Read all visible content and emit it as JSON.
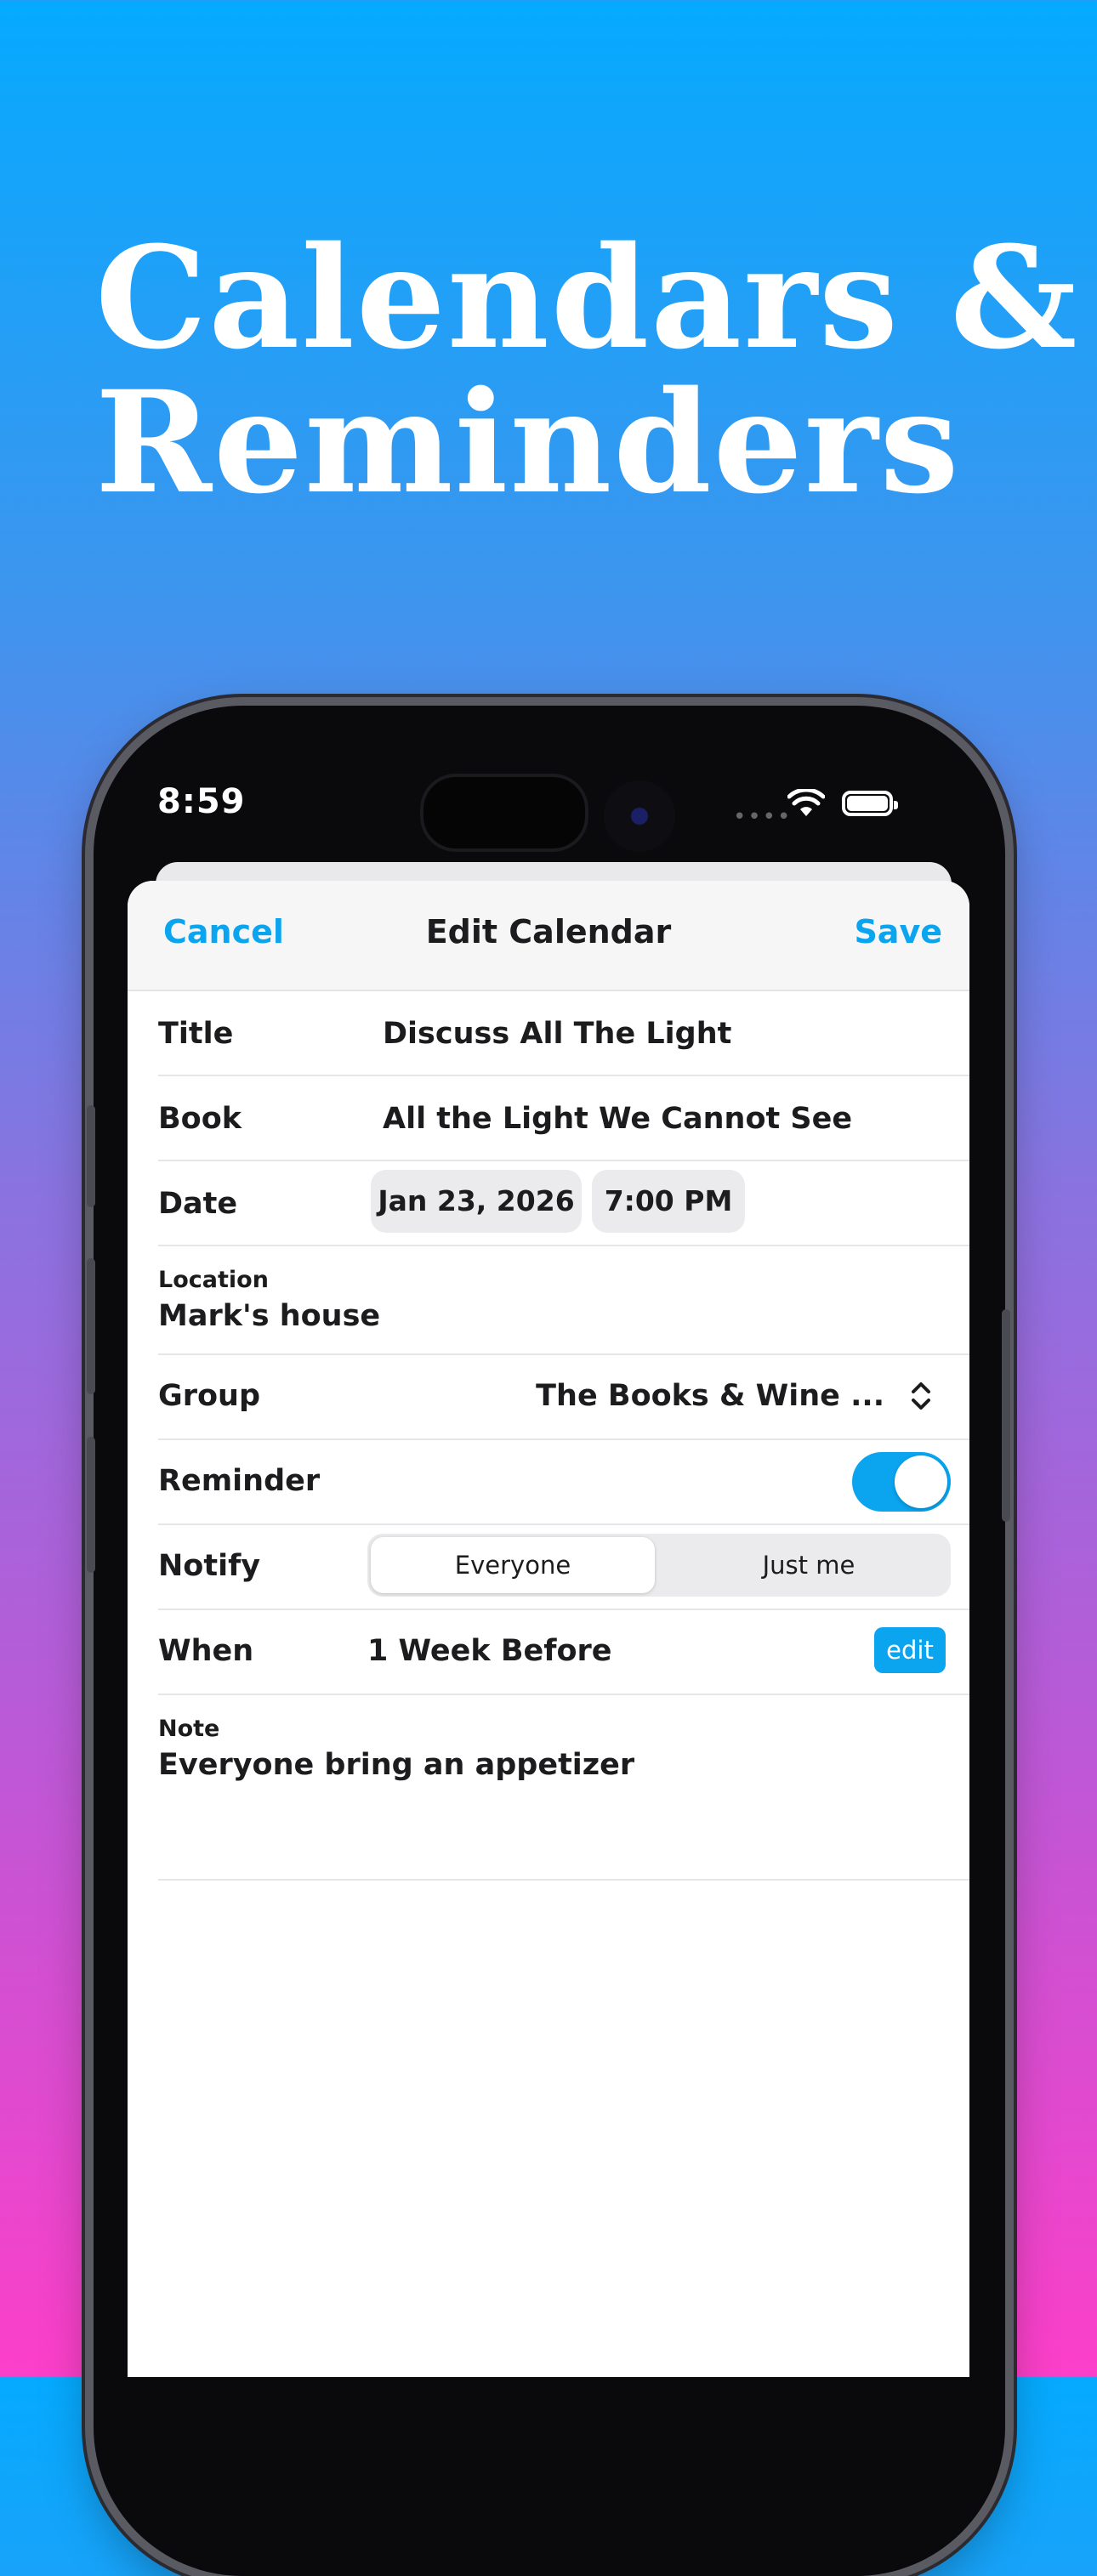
{
  "headline": {
    "line1": "Calendars &",
    "line2": "Reminders"
  },
  "status_bar": {
    "time": "8:59"
  },
  "nav": {
    "cancel": "Cancel",
    "title": "Edit Calendar",
    "save": "Save"
  },
  "form": {
    "title": {
      "label": "Title",
      "value": "Discuss All The Light"
    },
    "book": {
      "label": "Book",
      "value": "All the Light We Cannot See"
    },
    "date": {
      "label": "Date",
      "date_value": "Jan 23, 2026",
      "time_value": "7:00 PM"
    },
    "location": {
      "label": "Location",
      "value": "Mark's house"
    },
    "group": {
      "label": "Group",
      "value": "The Books & Wine ..."
    },
    "reminder": {
      "label": "Reminder",
      "enabled": true
    },
    "notify": {
      "label": "Notify",
      "options": [
        "Everyone",
        "Just me"
      ],
      "selected": "Everyone"
    },
    "when": {
      "label": "When",
      "value": "1 Week Before",
      "edit": "edit"
    },
    "note": {
      "label": "Note",
      "value": "Everyone bring an appetizer"
    }
  },
  "colors": {
    "accent": "#0aa4ef",
    "gradient_top": "#05aaff",
    "gradient_bottom": "#fc3fc9"
  },
  "icons": {
    "wifi": "wifi-icon",
    "battery": "battery-icon",
    "group_picker": "chevron-up-down-icon"
  }
}
